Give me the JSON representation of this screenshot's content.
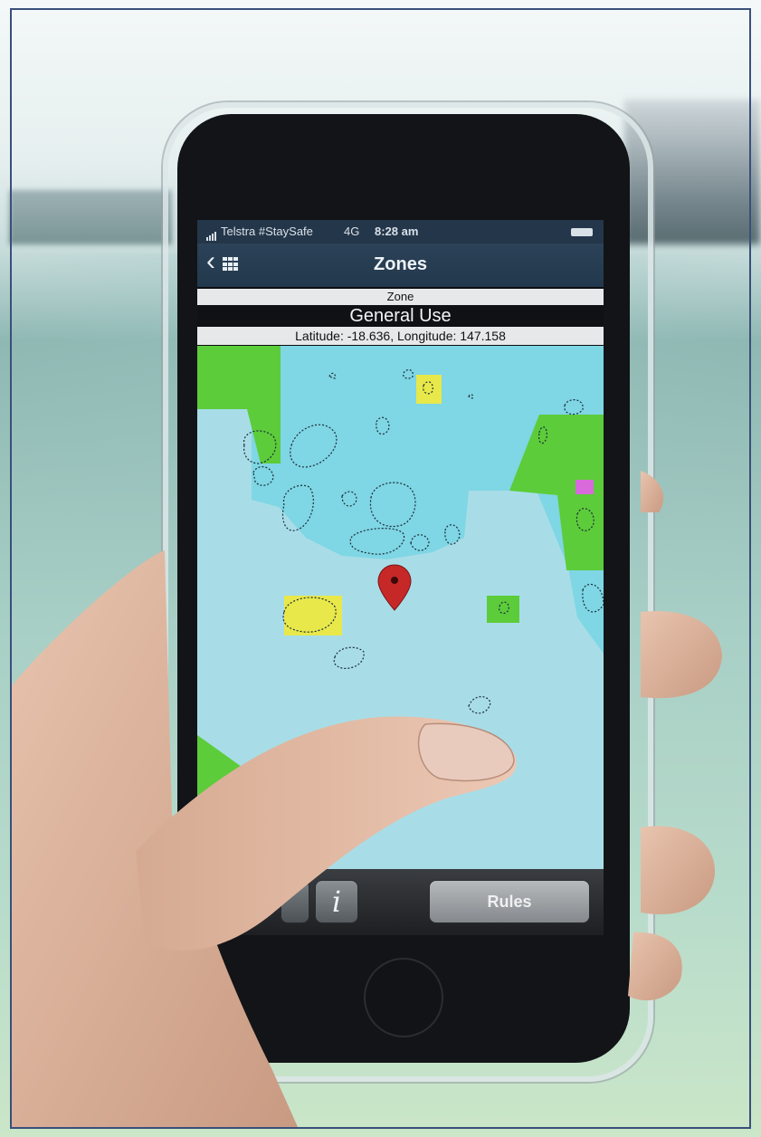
{
  "status_bar": {
    "carrier": "Telstra #StaySafe",
    "network": "4G",
    "time": "8:28 am"
  },
  "nav_bar": {
    "title": "Zones",
    "back_icon": "chevron-left-icon",
    "grid_icon": "grid-icon"
  },
  "zone_header": {
    "label": "Zone",
    "name": "General Use",
    "coordinates": "Latitude: -18.636, Longitude: 147.158"
  },
  "map": {
    "colors": {
      "deep_water": "#7fd6e4",
      "general_use": "#a8dde8",
      "green_zone": "#5ccc3a",
      "yellow_zone": "#e8e84a",
      "pink_zone": "#d86adc",
      "marker": "#c62828"
    },
    "marker_icon": "location-pin-icon"
  },
  "toolbar": {
    "info_label": "i",
    "rules_label": "Rules"
  }
}
